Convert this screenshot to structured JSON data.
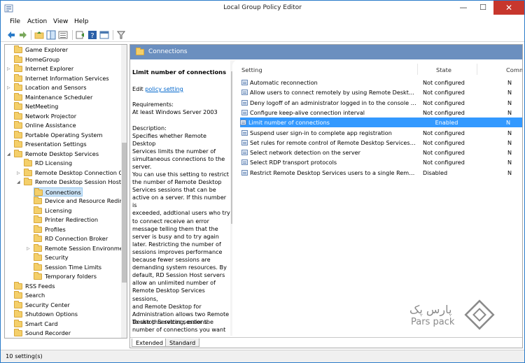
{
  "window": {
    "title": "Local Group Policy Editor",
    "min_glyph": "—",
    "max_glyph": "☐",
    "close_glyph": "✕"
  },
  "menu": [
    "File",
    "Action",
    "View",
    "Help"
  ],
  "tree": {
    "items": [
      {
        "label": "Game Explorer",
        "level": 0,
        "arrow": ""
      },
      {
        "label": "HomeGroup",
        "level": 0,
        "arrow": ""
      },
      {
        "label": "Internet Explorer",
        "level": 0,
        "arrow": "▷"
      },
      {
        "label": "Internet Information Services",
        "level": 0,
        "arrow": ""
      },
      {
        "label": "Location and Sensors",
        "level": 0,
        "arrow": "▷"
      },
      {
        "label": "Maintenance Scheduler",
        "level": 0,
        "arrow": ""
      },
      {
        "label": "NetMeeting",
        "level": 0,
        "arrow": ""
      },
      {
        "label": "Network Projector",
        "level": 0,
        "arrow": ""
      },
      {
        "label": "Online Assistance",
        "level": 0,
        "arrow": ""
      },
      {
        "label": "Portable Operating System",
        "level": 0,
        "arrow": ""
      },
      {
        "label": "Presentation Settings",
        "level": 0,
        "arrow": ""
      },
      {
        "label": "Remote Desktop Services",
        "level": 0,
        "arrow": "◢"
      },
      {
        "label": "RD Licensing",
        "level": 1,
        "arrow": ""
      },
      {
        "label": "Remote Desktop Connection C",
        "level": 1,
        "arrow": "▷"
      },
      {
        "label": "Remote Desktop Session Host",
        "level": 1,
        "arrow": "◢"
      },
      {
        "label": "Connections",
        "level": 2,
        "arrow": "",
        "selected": true
      },
      {
        "label": "Device and Resource Redire",
        "level": 2,
        "arrow": ""
      },
      {
        "label": "Licensing",
        "level": 2,
        "arrow": ""
      },
      {
        "label": "Printer Redirection",
        "level": 2,
        "arrow": ""
      },
      {
        "label": "Profiles",
        "level": 2,
        "arrow": ""
      },
      {
        "label": "RD Connection Broker",
        "level": 2,
        "arrow": ""
      },
      {
        "label": "Remote Session Environme",
        "level": 2,
        "arrow": "▷"
      },
      {
        "label": "Security",
        "level": 2,
        "arrow": ""
      },
      {
        "label": "Session Time Limits",
        "level": 2,
        "arrow": ""
      },
      {
        "label": "Temporary folders",
        "level": 2,
        "arrow": ""
      },
      {
        "label": "RSS Feeds",
        "level": 0,
        "arrow": ""
      },
      {
        "label": "Search",
        "level": 0,
        "arrow": ""
      },
      {
        "label": "Security Center",
        "level": 0,
        "arrow": ""
      },
      {
        "label": "Shutdown Options",
        "level": 0,
        "arrow": ""
      },
      {
        "label": "Smart Card",
        "level": 0,
        "arrow": ""
      },
      {
        "label": "Sound Recorder",
        "level": 0,
        "arrow": ""
      }
    ]
  },
  "header": {
    "title": "Connections"
  },
  "extended": {
    "title": "Limit number of connections",
    "edit_prefix": "Edit ",
    "edit_link": "policy setting",
    "requirements_label": "Requirements:",
    "requirements_value": "At least Windows Server 2003",
    "description_label": "Description:",
    "description_lines": [
      "Specifies whether Remote Desktop",
      "Services limits the number of",
      "simultaneous connections to the",
      "server."
    ],
    "para2_lines": [
      "You can use this setting to restrict",
      "the number of Remote Desktop",
      "Services sessions that can be",
      "active on a server. If this number is",
      "exceeded, addtional users who try",
      "to connect receive an error",
      "message telling them that the",
      "server is busy and to try again",
      "later. Restricting the number of",
      "sessions improves performance",
      "because fewer sessions are",
      "demanding system resources. By",
      "default, RD Session Host servers",
      "allow an unlimited number of",
      "Remote Desktop Services sessions,",
      "and Remote Desktop for",
      "Administration allows two Remote",
      "Desktop Services sessions."
    ],
    "para3_lines": [
      "To use this setting, enter the",
      "number of connections you want"
    ]
  },
  "list": {
    "columns": {
      "setting": "Setting",
      "state": "State",
      "comment": "Comm"
    },
    "rows": [
      {
        "setting": "Automatic reconnection",
        "state": "Not configured",
        "comment": "N"
      },
      {
        "setting": "Allow users to connect remotely by using Remote Desktop S...",
        "state": "Not configured",
        "comment": "N"
      },
      {
        "setting": "Deny logoff of an administrator logged in to the console ses...",
        "state": "Not configured",
        "comment": "N"
      },
      {
        "setting": "Configure keep-alive connection interval",
        "state": "Not configured",
        "comment": "N"
      },
      {
        "setting": "Limit number of connections",
        "state": "Enabled",
        "comment": "N",
        "selected": true
      },
      {
        "setting": "Suspend user sign-in to complete app registration",
        "state": "Not configured",
        "comment": "N"
      },
      {
        "setting": "Set rules for remote control of Remote Desktop Services use...",
        "state": "Not configured",
        "comment": "N"
      },
      {
        "setting": "Select network detection on the server",
        "state": "Not configured",
        "comment": "N"
      },
      {
        "setting": "Select RDP transport protocols",
        "state": "Not configured",
        "comment": "N"
      },
      {
        "setting": "Restrict Remote Desktop Services users to a single Remote D...",
        "state": "Disabled",
        "comment": "N"
      }
    ]
  },
  "tabs": {
    "extended": "Extended",
    "standard": "Standard"
  },
  "status": {
    "text": "10 setting(s)"
  },
  "watermark": {
    "arabic": "پارس پک",
    "latin": "Pars pack"
  },
  "colors": {
    "accent": "#3399ff",
    "header": "#6b8fbf",
    "close": "#c7372d"
  }
}
